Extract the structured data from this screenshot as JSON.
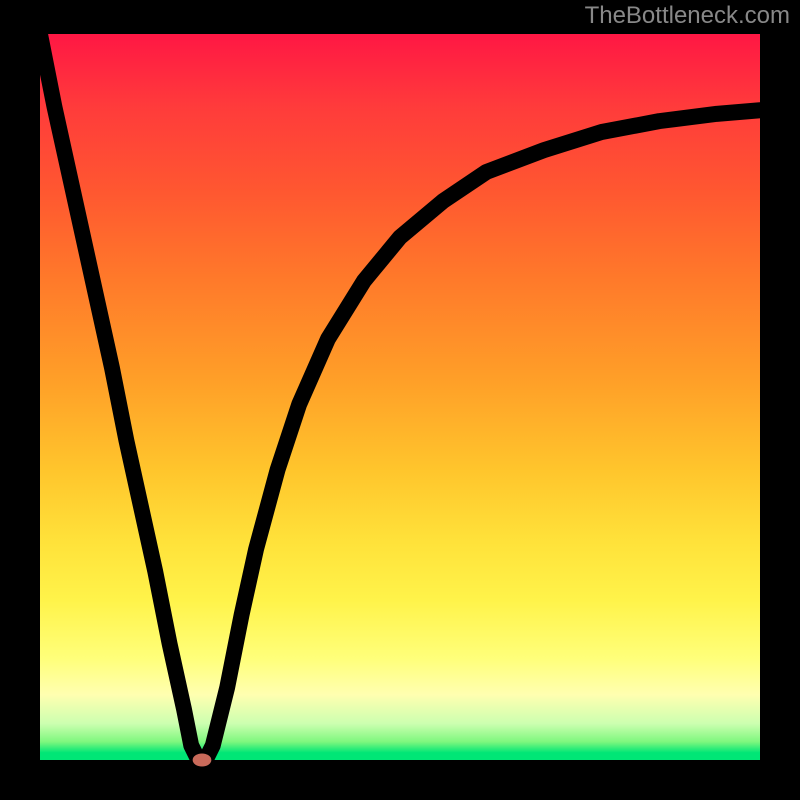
{
  "watermark": "TheBottleneck.com",
  "chart_data": {
    "type": "line",
    "title": "",
    "xlabel": "",
    "ylabel": "",
    "xlim": [
      0,
      100
    ],
    "ylim": [
      0,
      100
    ],
    "axes_visible": false,
    "grid": false,
    "background": "rainbow-gradient-vertical",
    "series": [
      {
        "name": "bottleneck-curve",
        "color": "#000000",
        "x": [
          0,
          2,
          4,
          6,
          8,
          10,
          12,
          14,
          16,
          18,
          20,
          21,
          22,
          23,
          24,
          26,
          28,
          30,
          33,
          36,
          40,
          45,
          50,
          56,
          62,
          70,
          78,
          86,
          94,
          100
        ],
        "y": [
          100,
          90,
          81,
          72,
          63,
          54,
          44,
          35,
          26,
          16,
          7,
          2,
          0,
          0,
          2,
          10,
          20,
          29,
          40,
          49,
          58,
          66,
          72,
          77,
          81,
          84,
          86.5,
          88,
          89,
          89.5
        ]
      }
    ],
    "marker": {
      "name": "min-point",
      "x": 22.5,
      "y": 0,
      "color": "#c96a5a",
      "rx": 1.3,
      "ry": 0.9
    },
    "gradient_stops": [
      {
        "pos": 0,
        "color": "#ff1744"
      },
      {
        "pos": 0.1,
        "color": "#ff3b3b"
      },
      {
        "pos": 0.22,
        "color": "#ff5830"
      },
      {
        "pos": 0.34,
        "color": "#ff7a2a"
      },
      {
        "pos": 0.48,
        "color": "#ffa028"
      },
      {
        "pos": 0.6,
        "color": "#ffc52c"
      },
      {
        "pos": 0.7,
        "color": "#ffe23a"
      },
      {
        "pos": 0.78,
        "color": "#fff34a"
      },
      {
        "pos": 0.86,
        "color": "#ffff7a"
      },
      {
        "pos": 0.91,
        "color": "#ffffb0"
      },
      {
        "pos": 0.95,
        "color": "#ccffb0"
      },
      {
        "pos": 0.975,
        "color": "#7ef77e"
      },
      {
        "pos": 0.99,
        "color": "#00e676"
      },
      {
        "pos": 1.0,
        "color": "#00e676"
      }
    ]
  }
}
